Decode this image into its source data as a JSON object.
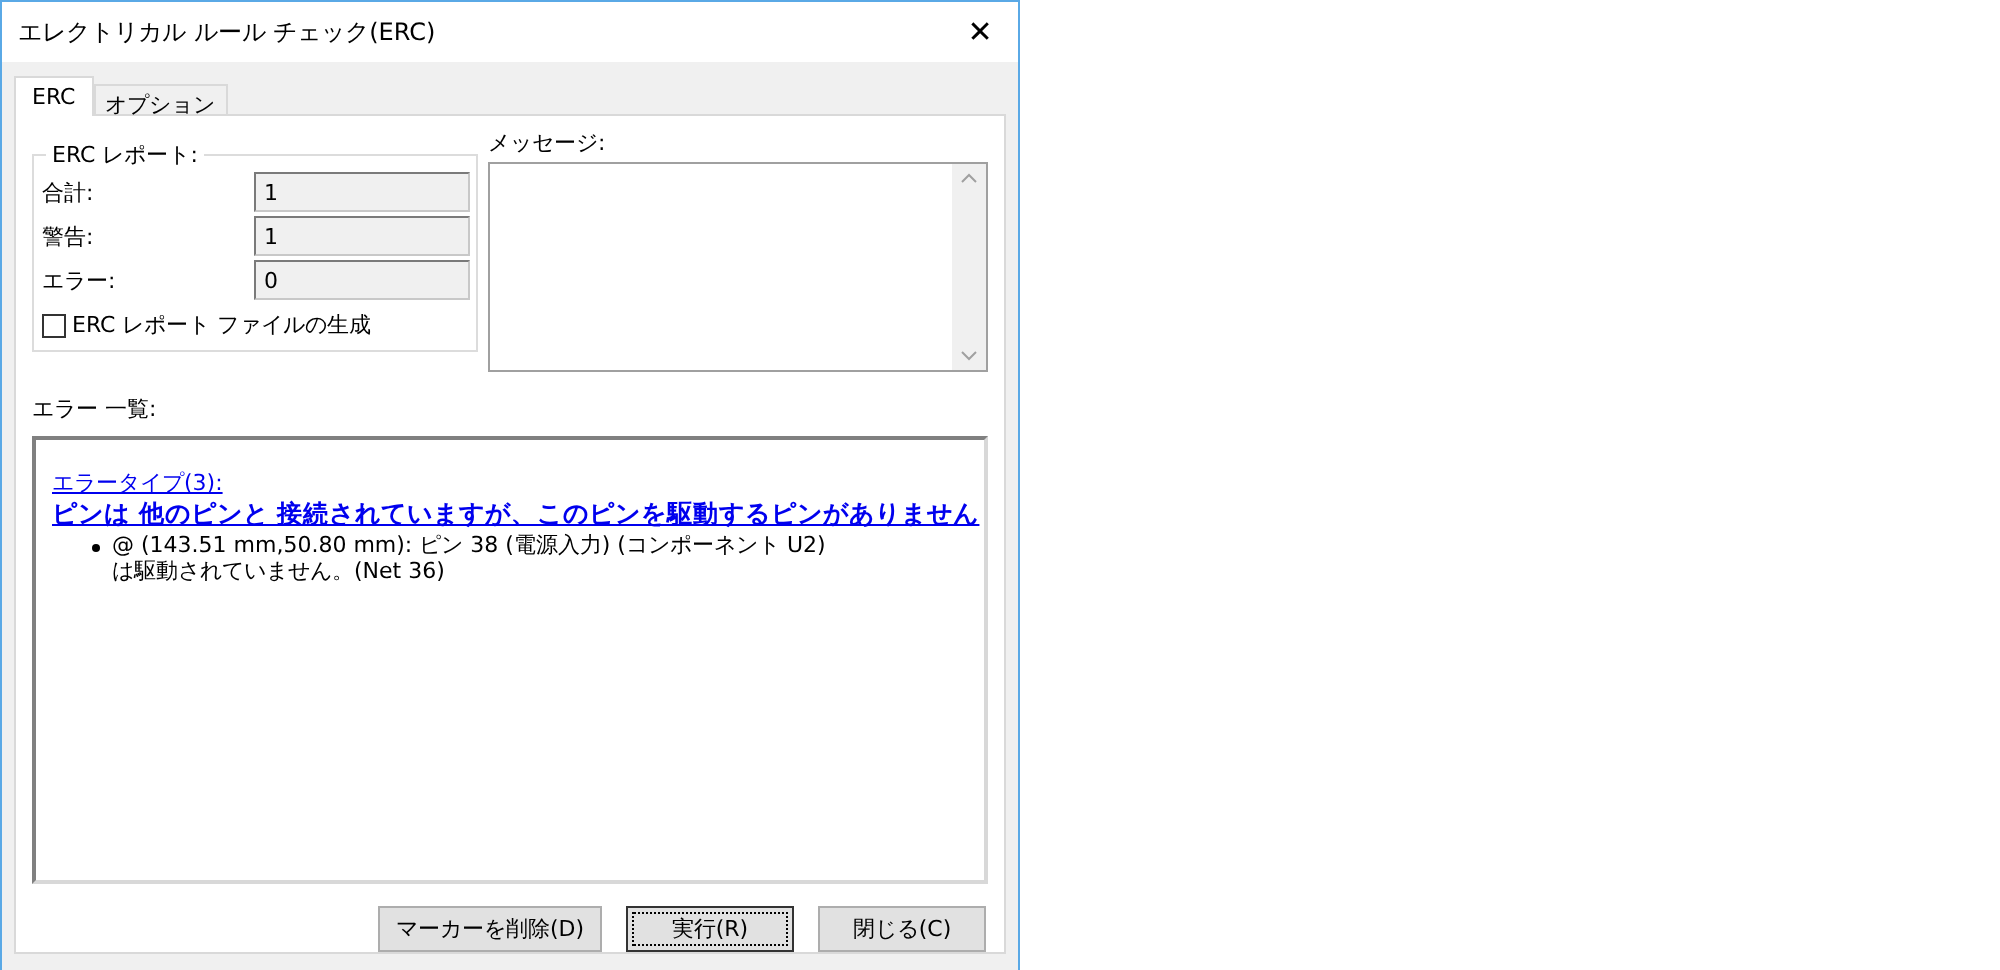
{
  "window": {
    "title": "エレクトリカル ルール チェック(ERC)",
    "close_glyph": "✕"
  },
  "tabs": [
    {
      "label": "ERC",
      "selected": true
    },
    {
      "label": "オプション",
      "selected": false
    }
  ],
  "report": {
    "title": "ERC レポート:",
    "fields": [
      {
        "label": "合計:",
        "value": "1"
      },
      {
        "label": "警告:",
        "value": "1"
      },
      {
        "label": "エラー:",
        "value": "0"
      }
    ],
    "checkbox": {
      "label": "ERC レポート ファイルの生成",
      "checked": false
    }
  },
  "messages": {
    "label": "メッセージ:"
  },
  "error_list": {
    "label": "エラー 一覧:",
    "groups": [
      {
        "type_link": "エラータイプ(3):",
        "title": "ピンは 他のピンと 接続されていますが、このピンを駆動するピンがありません",
        "items": [
          "@ (143.51 mm,50.80 mm): ピン 38 (電源入力) (コンポーネント U2)\nは駆動されていません。(Net 36)"
        ]
      }
    ]
  },
  "buttons": [
    {
      "label": "マーカーを削除(D)",
      "focused": false
    },
    {
      "label": "実行(R)",
      "focused": true
    },
    {
      "label": "閉じる(C)",
      "focused": false
    }
  ]
}
